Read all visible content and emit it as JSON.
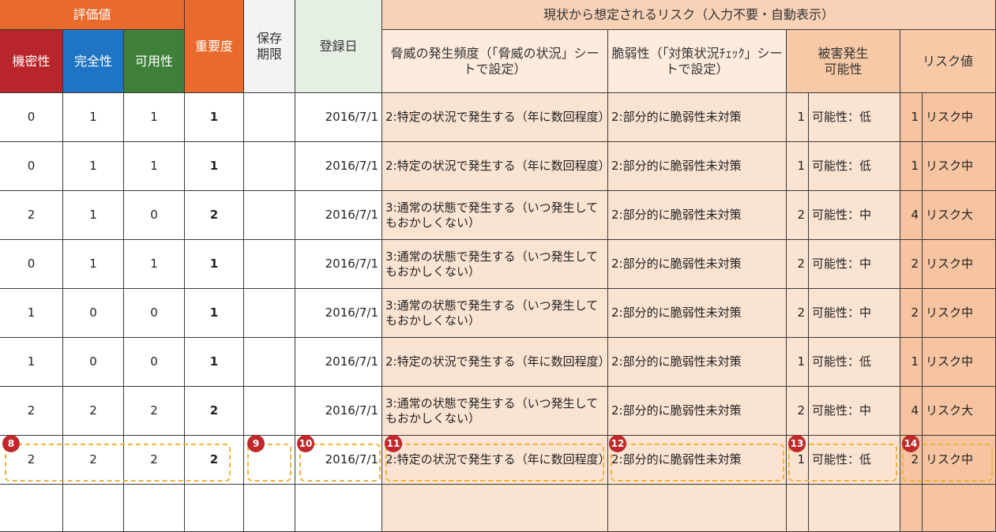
{
  "header": {
    "group_eval": "評価値",
    "confidentiality": "機密性",
    "integrity": "完全性",
    "availability": "可用性",
    "importance": "重要度",
    "retention_period": "保存\n期限",
    "registration_date": "登録日",
    "risk_group": "現状から想定されるリスク（入力不要・自動表示）",
    "threat_frequency": "脅威の発生頻度（「脅威の状況」シートで設定）",
    "vulnerability": "脆弱性（「対策状況ﾁｪｯｸ」シートで設定）",
    "damage_possibility": "被害発生\n可能性",
    "risk_value": "リスク値"
  },
  "rows": [
    {
      "c": "0",
      "i": "1",
      "a": "1",
      "imp": "1",
      "ret": "",
      "date": "2016/7/1",
      "threat": "2:特定の状況で発生する（年に数回程度）",
      "vuln": "2:部分的に脆弱性未対策",
      "pn": "1",
      "pl": "可能性：低",
      "rn": "1",
      "rl": "リスク中"
    },
    {
      "c": "0",
      "i": "1",
      "a": "1",
      "imp": "1",
      "ret": "",
      "date": "2016/7/1",
      "threat": "2:特定の状況で発生する（年に数回程度）",
      "vuln": "2:部分的に脆弱性未対策",
      "pn": "1",
      "pl": "可能性：低",
      "rn": "1",
      "rl": "リスク中"
    },
    {
      "c": "2",
      "i": "1",
      "a": "0",
      "imp": "2",
      "ret": "",
      "date": "2016/7/1",
      "threat": "3:通常の状態で発生する（いつ発生してもおかしくない）",
      "vuln": "2:部分的に脆弱性未対策",
      "pn": "2",
      "pl": "可能性：中",
      "rn": "4",
      "rl": "リスク大"
    },
    {
      "c": "0",
      "i": "1",
      "a": "1",
      "imp": "1",
      "ret": "",
      "date": "2016/7/1",
      "threat": "3:通常の状態で発生する（いつ発生してもおかしくない）",
      "vuln": "2:部分的に脆弱性未対策",
      "pn": "2",
      "pl": "可能性：中",
      "rn": "2",
      "rl": "リスク中"
    },
    {
      "c": "1",
      "i": "0",
      "a": "0",
      "imp": "1",
      "ret": "",
      "date": "2016/7/1",
      "threat": "3:通常の状態で発生する（いつ発生してもおかしくない）",
      "vuln": "2:部分的に脆弱性未対策",
      "pn": "2",
      "pl": "可能性：中",
      "rn": "2",
      "rl": "リスク中"
    },
    {
      "c": "1",
      "i": "0",
      "a": "0",
      "imp": "1",
      "ret": "",
      "date": "2016/7/1",
      "threat": "2:特定の状況で発生する（年に数回程度）",
      "vuln": "2:部分的に脆弱性未対策",
      "pn": "1",
      "pl": "可能性：低",
      "rn": "1",
      "rl": "リスク中"
    },
    {
      "c": "2",
      "i": "2",
      "a": "2",
      "imp": "2",
      "ret": "",
      "date": "2016/7/1",
      "threat": "3:通常の状態で発生する（いつ発生してもおかしくない）",
      "vuln": "2:部分的に脆弱性未対策",
      "pn": "2",
      "pl": "可能性：中",
      "rn": "4",
      "rl": "リスク大"
    },
    {
      "c": "2",
      "i": "2",
      "a": "2",
      "imp": "2",
      "ret": "",
      "date": "2016/7/1",
      "threat": "2:特定の状況で発生する（年に数回程度）",
      "vuln": "2:部分的に脆弱性未対策",
      "pn": "1",
      "pl": "可能性：低",
      "rn": "2",
      "rl": "リスク中"
    },
    {
      "c": "",
      "i": "",
      "a": "",
      "imp": "",
      "ret": "",
      "date": "",
      "threat": "",
      "vuln": "",
      "pn": "",
      "pl": "",
      "rn": "",
      "rl": ""
    }
  ],
  "badges": {
    "b8": "8",
    "b9": "9",
    "b10": "10",
    "b11": "11",
    "b12": "12",
    "b13": "13",
    "b14": "14"
  }
}
